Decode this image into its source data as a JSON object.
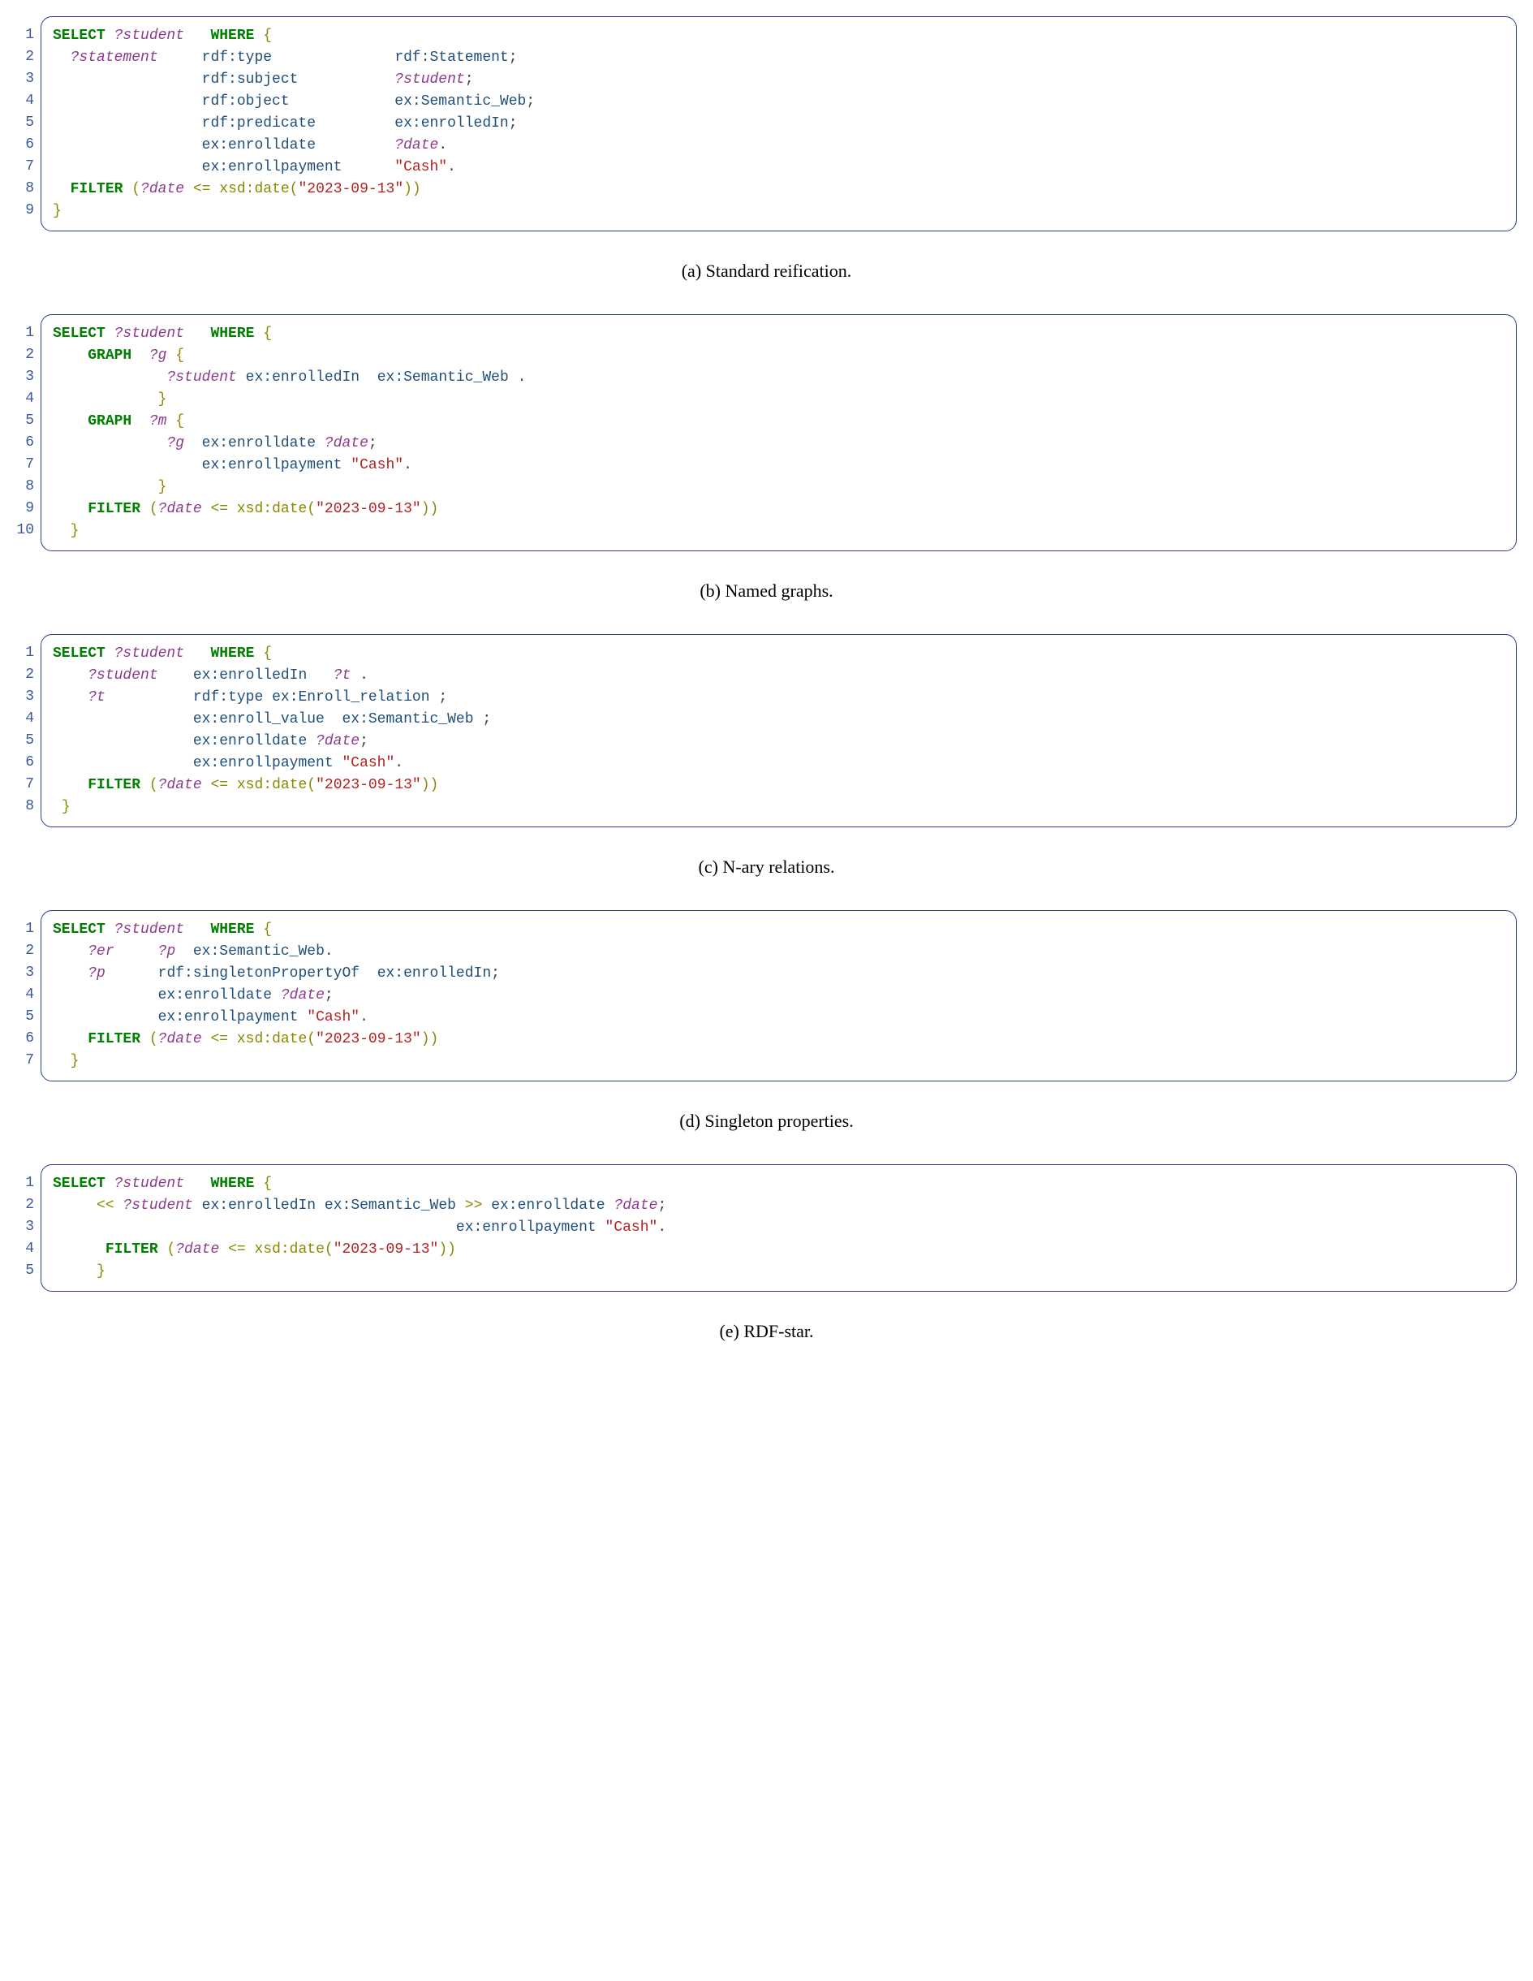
{
  "blocks": [
    {
      "id": "a",
      "caption": "(a) Standard reification.",
      "lines": [
        [
          [
            "kw",
            "SELECT"
          ],
          [
            "pl",
            " "
          ],
          [
            "var",
            "?student"
          ],
          [
            "pl",
            "   "
          ],
          [
            "kw",
            "WHERE"
          ],
          [
            "pl",
            " "
          ],
          [
            "br",
            "{"
          ]
        ],
        [
          [
            "pl",
            "  "
          ],
          [
            "var",
            "?statement"
          ],
          [
            "pl",
            "     "
          ],
          [
            "pred",
            "rdf:type"
          ],
          [
            "pl",
            "              "
          ],
          [
            "pred",
            "rdf:Statement"
          ],
          [
            "punc",
            ";"
          ]
        ],
        [
          [
            "pl",
            "                 "
          ],
          [
            "pred",
            "rdf:subject"
          ],
          [
            "pl",
            "           "
          ],
          [
            "var",
            "?student"
          ],
          [
            "punc",
            ";"
          ]
        ],
        [
          [
            "pl",
            "                 "
          ],
          [
            "pred",
            "rdf:object"
          ],
          [
            "pl",
            "            "
          ],
          [
            "pred",
            "ex:Semantic_Web"
          ],
          [
            "punc",
            ";"
          ]
        ],
        [
          [
            "pl",
            "                 "
          ],
          [
            "pred",
            "rdf:predicate"
          ],
          [
            "pl",
            "         "
          ],
          [
            "pred",
            "ex:enrolledIn"
          ],
          [
            "punc",
            ";"
          ]
        ],
        [
          [
            "pl",
            "                 "
          ],
          [
            "pred",
            "ex:enrolldate"
          ],
          [
            "pl",
            "         "
          ],
          [
            "var",
            "?date"
          ],
          [
            "punc",
            "."
          ]
        ],
        [
          [
            "pl",
            "                 "
          ],
          [
            "pred",
            "ex:enrollpayment"
          ],
          [
            "pl",
            "      "
          ],
          [
            "str",
            "\"Cash\""
          ],
          [
            "punc",
            "."
          ]
        ],
        [
          [
            "pl",
            "  "
          ],
          [
            "kw",
            "FILTER"
          ],
          [
            "pl",
            " "
          ],
          [
            "filt",
            "("
          ],
          [
            "var",
            "?date"
          ],
          [
            "filt",
            " <= xsd:date("
          ],
          [
            "str",
            "\"2023-09-13\""
          ],
          [
            "filt",
            "))"
          ]
        ],
        [
          [
            "br",
            "}"
          ]
        ]
      ]
    },
    {
      "id": "b",
      "caption": "(b) Named graphs.",
      "lines": [
        [
          [
            "kw",
            "SELECT"
          ],
          [
            "pl",
            " "
          ],
          [
            "var",
            "?student"
          ],
          [
            "pl",
            "   "
          ],
          [
            "kw",
            "WHERE"
          ],
          [
            "pl",
            " "
          ],
          [
            "br",
            "{"
          ]
        ],
        [
          [
            "pl",
            "    "
          ],
          [
            "kw",
            "GRAPH"
          ],
          [
            "pl",
            "  "
          ],
          [
            "var",
            "?g"
          ],
          [
            "pl",
            " "
          ],
          [
            "br",
            "{"
          ]
        ],
        [
          [
            "pl",
            "             "
          ],
          [
            "var",
            "?student"
          ],
          [
            "pl",
            " "
          ],
          [
            "pred",
            "ex:enrolledIn"
          ],
          [
            "pl",
            "  "
          ],
          [
            "pred",
            "ex:Semantic_Web"
          ],
          [
            "pl",
            " "
          ],
          [
            "punc",
            "."
          ]
        ],
        [
          [
            "pl",
            "            "
          ],
          [
            "br",
            "}"
          ]
        ],
        [
          [
            "pl",
            "    "
          ],
          [
            "kw",
            "GRAPH"
          ],
          [
            "pl",
            "  "
          ],
          [
            "var",
            "?m"
          ],
          [
            "pl",
            " "
          ],
          [
            "br",
            "{"
          ]
        ],
        [
          [
            "pl",
            "             "
          ],
          [
            "var",
            "?g"
          ],
          [
            "pl",
            "  "
          ],
          [
            "pred",
            "ex:enrolldate"
          ],
          [
            "pl",
            " "
          ],
          [
            "var",
            "?date"
          ],
          [
            "punc",
            ";"
          ]
        ],
        [
          [
            "pl",
            "                 "
          ],
          [
            "pred",
            "ex:enrollpayment"
          ],
          [
            "pl",
            " "
          ],
          [
            "str",
            "\"Cash\""
          ],
          [
            "punc",
            "."
          ]
        ],
        [
          [
            "pl",
            "            "
          ],
          [
            "br",
            "}"
          ]
        ],
        [
          [
            "pl",
            "    "
          ],
          [
            "kw",
            "FILTER"
          ],
          [
            "pl",
            " "
          ],
          [
            "filt",
            "("
          ],
          [
            "var",
            "?date"
          ],
          [
            "filt",
            " <= xsd:date("
          ],
          [
            "str",
            "\"2023-09-13\""
          ],
          [
            "filt",
            "))"
          ]
        ],
        [
          [
            "pl",
            "  "
          ],
          [
            "br",
            "}"
          ]
        ]
      ]
    },
    {
      "id": "c",
      "caption": "(c) N-ary relations.",
      "lines": [
        [
          [
            "kw",
            "SELECT"
          ],
          [
            "pl",
            " "
          ],
          [
            "var",
            "?student"
          ],
          [
            "pl",
            "   "
          ],
          [
            "kw",
            "WHERE"
          ],
          [
            "pl",
            " "
          ],
          [
            "br",
            "{"
          ]
        ],
        [
          [
            "pl",
            "    "
          ],
          [
            "var",
            "?student"
          ],
          [
            "pl",
            "    "
          ],
          [
            "pred",
            "ex:enrolledIn"
          ],
          [
            "pl",
            "   "
          ],
          [
            "var",
            "?t"
          ],
          [
            "pl",
            " "
          ],
          [
            "punc",
            "."
          ]
        ],
        [
          [
            "pl",
            "    "
          ],
          [
            "var",
            "?t"
          ],
          [
            "pl",
            "          "
          ],
          [
            "pred",
            "rdf:type"
          ],
          [
            "pl",
            " "
          ],
          [
            "pred",
            "ex:Enroll_relation"
          ],
          [
            "pl",
            " "
          ],
          [
            "punc",
            ";"
          ]
        ],
        [
          [
            "pl",
            "                "
          ],
          [
            "pred",
            "ex:enroll_value"
          ],
          [
            "pl",
            "  "
          ],
          [
            "pred",
            "ex:Semantic_Web"
          ],
          [
            "pl",
            " "
          ],
          [
            "punc",
            ";"
          ]
        ],
        [
          [
            "pl",
            "                "
          ],
          [
            "pred",
            "ex:enrolldate"
          ],
          [
            "pl",
            " "
          ],
          [
            "var",
            "?date"
          ],
          [
            "punc",
            ";"
          ]
        ],
        [
          [
            "pl",
            "                "
          ],
          [
            "pred",
            "ex:enrollpayment"
          ],
          [
            "pl",
            " "
          ],
          [
            "str",
            "\"Cash\""
          ],
          [
            "punc",
            "."
          ]
        ],
        [
          [
            "pl",
            "    "
          ],
          [
            "kw",
            "FILTER"
          ],
          [
            "pl",
            " "
          ],
          [
            "filt",
            "("
          ],
          [
            "var",
            "?date"
          ],
          [
            "filt",
            " <= xsd:date("
          ],
          [
            "str",
            "\"2023-09-13\""
          ],
          [
            "filt",
            "))"
          ]
        ],
        [
          [
            "pl",
            " "
          ],
          [
            "br",
            "}"
          ]
        ]
      ]
    },
    {
      "id": "d",
      "caption": "(d) Singleton properties.",
      "lines": [
        [
          [
            "kw",
            "SELECT"
          ],
          [
            "pl",
            " "
          ],
          [
            "var",
            "?student"
          ],
          [
            "pl",
            "   "
          ],
          [
            "kw",
            "WHERE"
          ],
          [
            "pl",
            " "
          ],
          [
            "br",
            "{"
          ]
        ],
        [
          [
            "pl",
            "    "
          ],
          [
            "var",
            "?er"
          ],
          [
            "pl",
            "     "
          ],
          [
            "var",
            "?p"
          ],
          [
            "pl",
            "  "
          ],
          [
            "pred",
            "ex:Semantic_Web"
          ],
          [
            "punc",
            "."
          ]
        ],
        [
          [
            "pl",
            "    "
          ],
          [
            "var",
            "?p"
          ],
          [
            "pl",
            "      "
          ],
          [
            "pred",
            "rdf:singletonPropertyOf"
          ],
          [
            "pl",
            "  "
          ],
          [
            "pred",
            "ex:enrolledIn"
          ],
          [
            "punc",
            ";"
          ]
        ],
        [
          [
            "pl",
            "            "
          ],
          [
            "pred",
            "ex:enrolldate"
          ],
          [
            "pl",
            " "
          ],
          [
            "var",
            "?date"
          ],
          [
            "punc",
            ";"
          ]
        ],
        [
          [
            "pl",
            "            "
          ],
          [
            "pred",
            "ex:enrollpayment"
          ],
          [
            "pl",
            " "
          ],
          [
            "str",
            "\"Cash\""
          ],
          [
            "punc",
            "."
          ]
        ],
        [
          [
            "pl",
            "    "
          ],
          [
            "kw",
            "FILTER"
          ],
          [
            "pl",
            " "
          ],
          [
            "filt",
            "("
          ],
          [
            "var",
            "?date"
          ],
          [
            "filt",
            " <= xsd:date("
          ],
          [
            "str",
            "\"2023-09-13\""
          ],
          [
            "filt",
            "))"
          ]
        ],
        [
          [
            "pl",
            "  "
          ],
          [
            "br",
            "}"
          ]
        ]
      ]
    },
    {
      "id": "e",
      "caption": "(e) RDF-star.",
      "lines": [
        [
          [
            "kw",
            "SELECT"
          ],
          [
            "pl",
            " "
          ],
          [
            "var",
            "?student"
          ],
          [
            "pl",
            "   "
          ],
          [
            "kw",
            "WHERE"
          ],
          [
            "pl",
            " "
          ],
          [
            "br",
            "{"
          ]
        ],
        [
          [
            "pl",
            "     "
          ],
          [
            "filt",
            "<<"
          ],
          [
            "pl",
            " "
          ],
          [
            "var",
            "?student"
          ],
          [
            "pl",
            " "
          ],
          [
            "pred",
            "ex:enrolledIn"
          ],
          [
            "pl",
            " "
          ],
          [
            "pred",
            "ex:Semantic_Web"
          ],
          [
            "pl",
            " "
          ],
          [
            "filt",
            ">>"
          ],
          [
            "pl",
            " "
          ],
          [
            "pred",
            "ex:enrolldate"
          ],
          [
            "pl",
            " "
          ],
          [
            "var",
            "?date"
          ],
          [
            "punc",
            ";"
          ]
        ],
        [
          [
            "pl",
            "                                              "
          ],
          [
            "pred",
            "ex:enrollpayment"
          ],
          [
            "pl",
            " "
          ],
          [
            "str",
            "\"Cash\""
          ],
          [
            "punc",
            "."
          ]
        ],
        [
          [
            "pl",
            "      "
          ],
          [
            "kw",
            "FILTER"
          ],
          [
            "pl",
            " "
          ],
          [
            "filt",
            "("
          ],
          [
            "var",
            "?date"
          ],
          [
            "filt",
            " <= xsd:date("
          ],
          [
            "str",
            "\"2023-09-13\""
          ],
          [
            "filt",
            "))"
          ]
        ],
        [
          [
            "pl",
            "     "
          ],
          [
            "br",
            "}"
          ]
        ]
      ]
    }
  ]
}
